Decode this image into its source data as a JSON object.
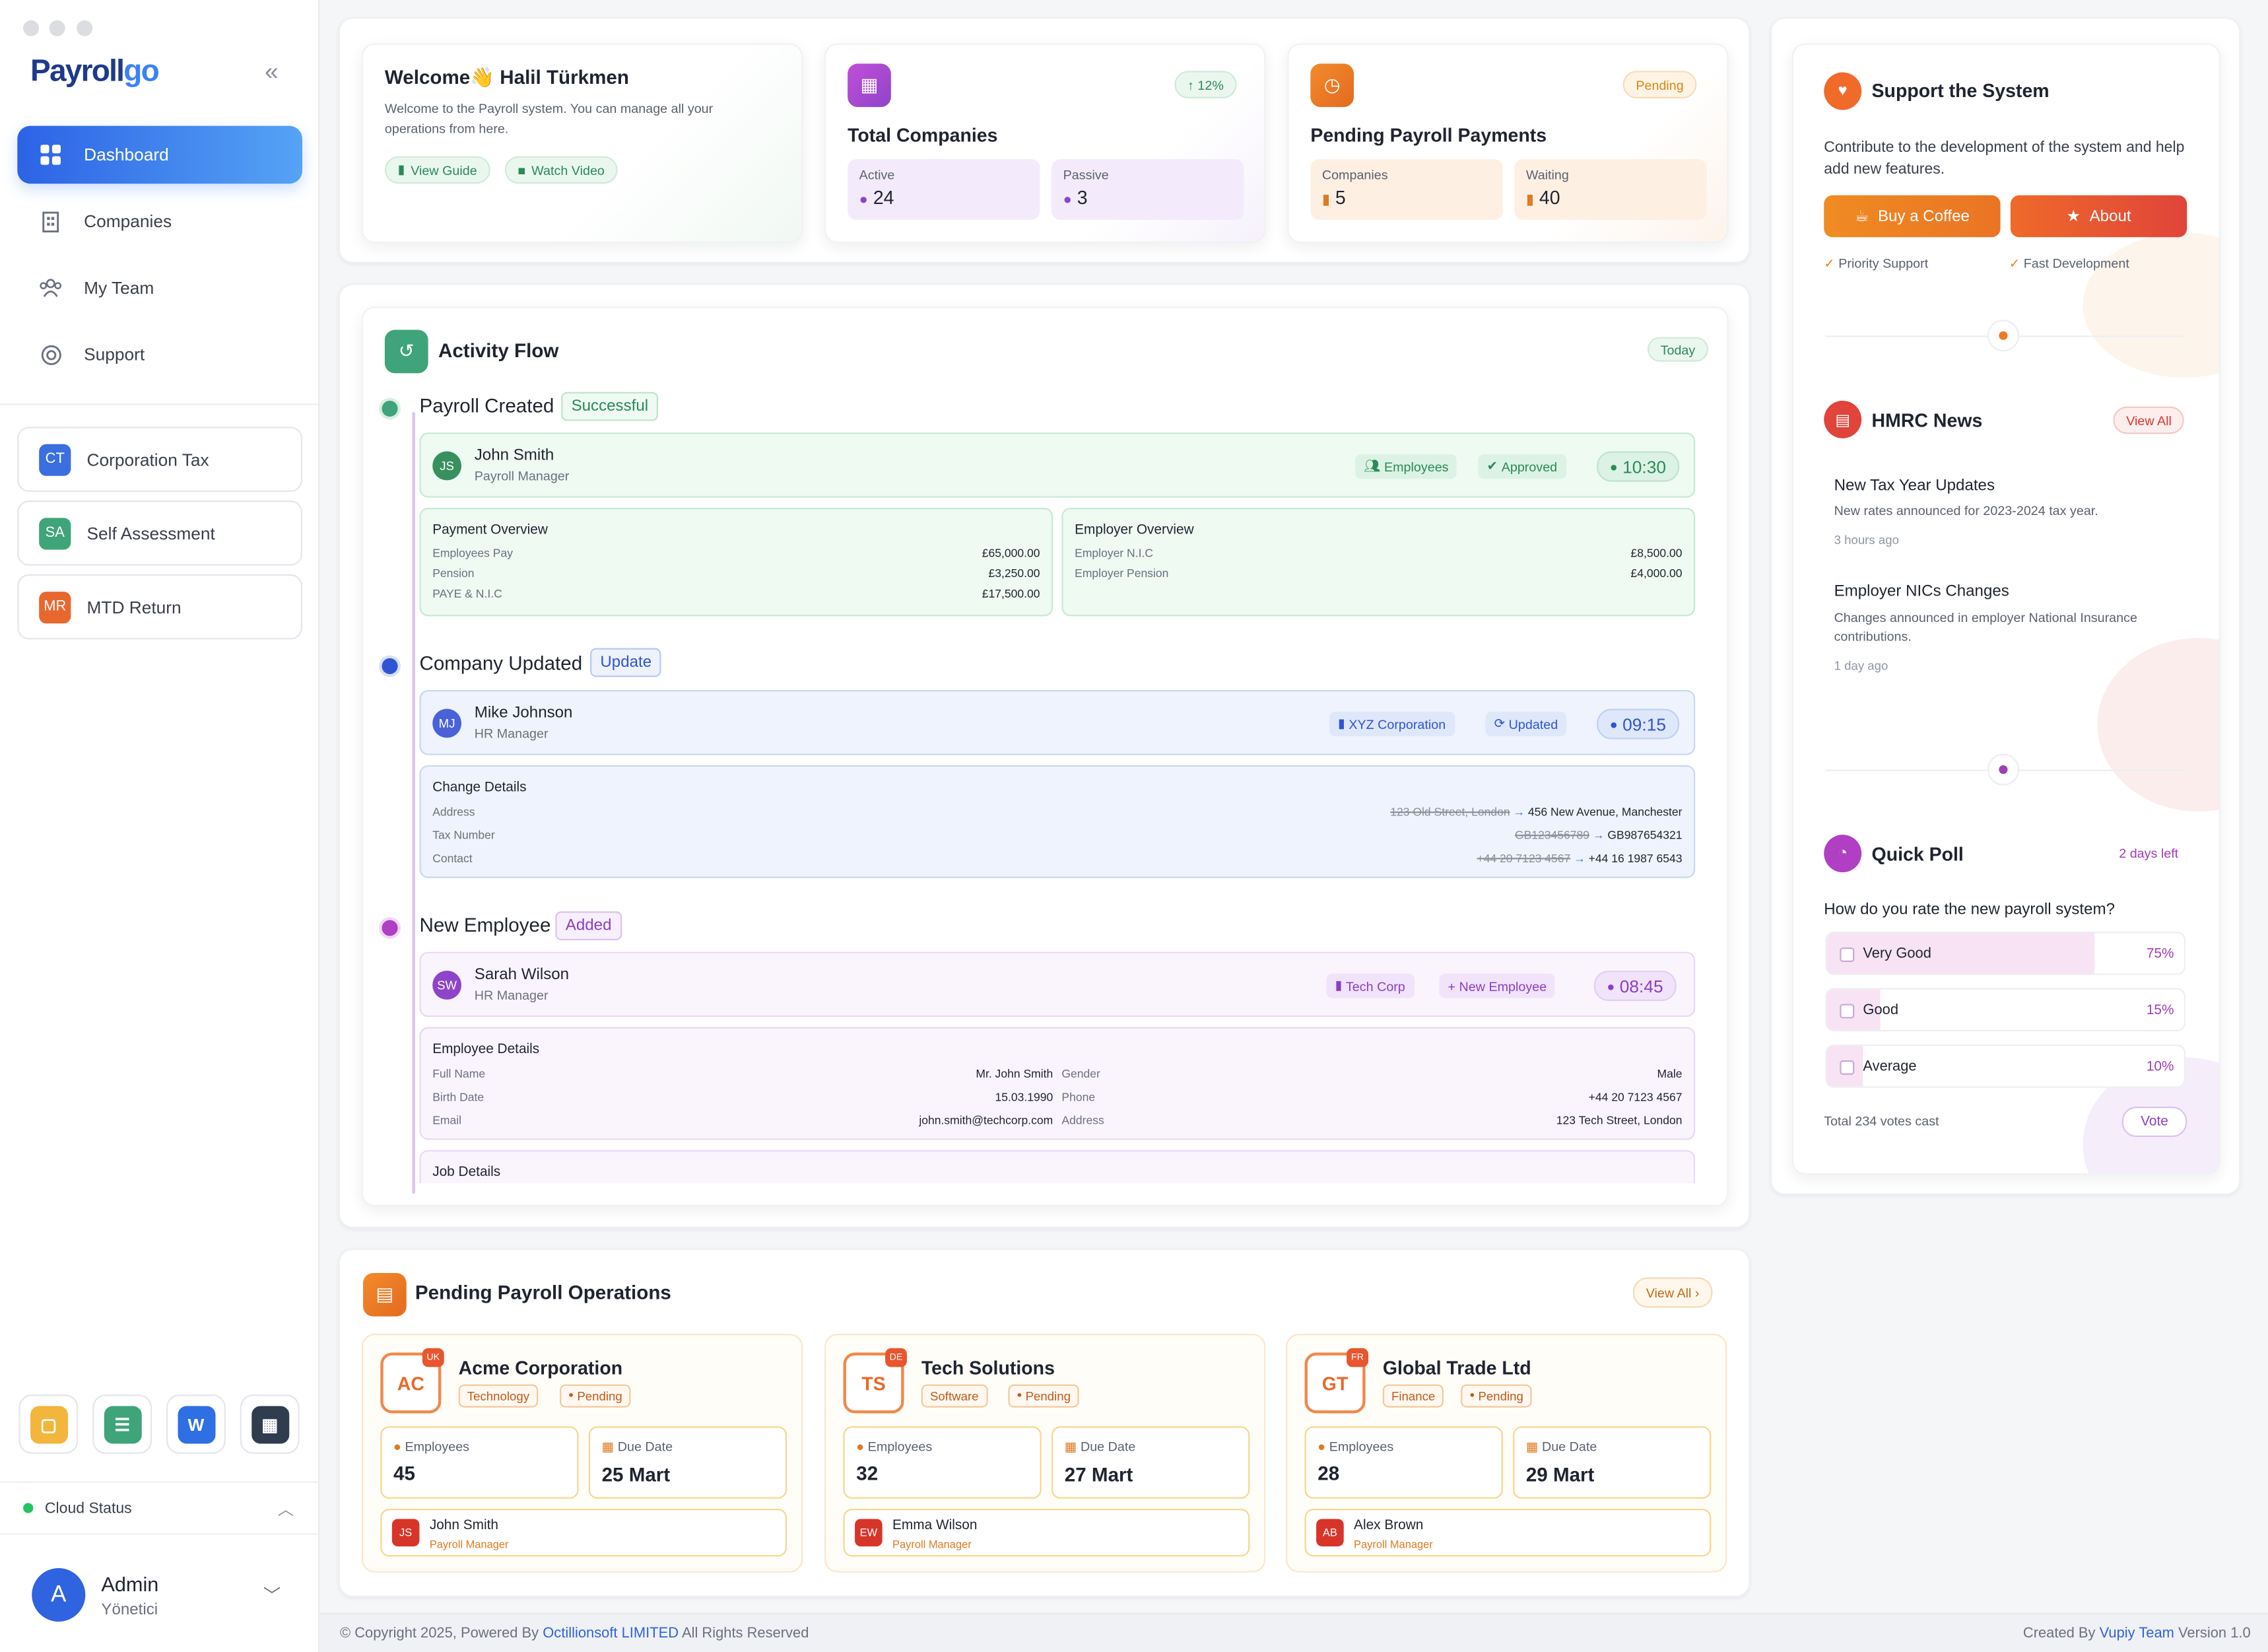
{
  "app": {
    "logo_main": "Payroll",
    "logo_accent": "go"
  },
  "sidebar": {
    "nav": [
      {
        "label": "Dashboard"
      },
      {
        "label": "Companies"
      },
      {
        "label": "My Team"
      },
      {
        "label": "Support"
      }
    ],
    "tax": [
      {
        "badge": "CT",
        "label": "Corporation Tax",
        "color": "#3b6fe0"
      },
      {
        "badge": "SA",
        "label": "Self Assessment",
        "color": "#3fa47a"
      },
      {
        "badge": "MR",
        "label": "MTD Return",
        "color": "#e8672e"
      }
    ],
    "cloud_status": "Cloud Status",
    "user": {
      "initial": "A",
      "name": "Admin",
      "role": "Yönetici"
    }
  },
  "welcome": {
    "title": "Welcome👋 Halil Türkmen",
    "desc": "Welcome to the Payroll system. You can manage all your operations from here.",
    "guide": "View Guide",
    "video": "Watch Video"
  },
  "companies": {
    "title": "Total Companies",
    "change": "↑ 12%",
    "active_label": "Active",
    "active": "24",
    "passive_label": "Passive",
    "passive": "3"
  },
  "pending": {
    "title": "Pending Payroll Payments",
    "status": "Pending",
    "c_label": "Companies",
    "c_val": "5",
    "w_label": "Waiting",
    "w_val": "40"
  },
  "activity": {
    "title": "Activity Flow",
    "badge": "Today",
    "e1": {
      "title": "Payroll Created",
      "status": "Successful",
      "initials": "JS",
      "name": "John Smith",
      "role": "Payroll Manager",
      "tag1": "Employees",
      "tag2": "Approved",
      "time": "10:30",
      "pay_title": "Payment Overview",
      "pay": [
        [
          "Employees Pay",
          "£65,000.00"
        ],
        [
          "Pension",
          "£3,250.00"
        ],
        [
          "PAYE & N.I.C",
          "£17,500.00"
        ]
      ],
      "emp_title": "Employer Overview",
      "emp": [
        [
          "Employer N.I.C",
          "£8,500.00"
        ],
        [
          "Employer Pension",
          "£4,000.00"
        ]
      ]
    },
    "e2": {
      "title": "Company Updated",
      "status": "Update",
      "initials": "MJ",
      "name": "Mike Johnson",
      "role": "HR Manager",
      "tag1": "XYZ Corporation",
      "tag2": "Updated",
      "time": "09:15",
      "chg_title": "Change Details",
      "chg": [
        [
          "Address",
          "123 Old Street, London",
          "456 New Avenue, Manchester"
        ],
        [
          "Tax Number",
          "GB123456789",
          "GB987654321"
        ],
        [
          "Contact",
          "+44 20 7123 4567",
          "+44 16 1987 6543"
        ]
      ]
    },
    "e3": {
      "title": "New Employee",
      "status": "Added",
      "initials": "SW",
      "name": "Sarah Wilson",
      "role": "HR Manager",
      "tag1": "Tech Corp",
      "tag2": "New Employee",
      "time": "08:45",
      "det_title": "Employee Details",
      "left": [
        [
          "Full Name",
          "Mr. John Smith"
        ],
        [
          "Birth Date",
          "15.03.1990"
        ],
        [
          "Email",
          "john.smith@techcorp.com"
        ]
      ],
      "right": [
        [
          "Gender",
          "Male"
        ],
        [
          "Phone",
          "+44 20 7123 4567"
        ],
        [
          "Address",
          "123 Tech Street, London"
        ]
      ],
      "job_title": "Job Details"
    }
  },
  "operations": {
    "title": "Pending Payroll Operations",
    "view_all": "View All",
    "items": [
      {
        "badge": "AC",
        "flag": "UK",
        "name": "Acme Corporation",
        "sector": "Technology",
        "status": "Pending",
        "emp_label": "Employees",
        "emp": "45",
        "due_label": "Due Date",
        "due": "25 Mart",
        "m_init": "JS",
        "m_name": "John Smith",
        "m_role": "Payroll Manager"
      },
      {
        "badge": "TS",
        "flag": "DE",
        "name": "Tech Solutions",
        "sector": "Software",
        "status": "Pending",
        "emp_label": "Employees",
        "emp": "32",
        "due_label": "Due Date",
        "due": "27 Mart",
        "m_init": "EW",
        "m_name": "Emma Wilson",
        "m_role": "Payroll Manager"
      },
      {
        "badge": "GT",
        "flag": "FR",
        "name": "Global Trade Ltd",
        "sector": "Finance",
        "status": "Pending",
        "emp_label": "Employees",
        "emp": "28",
        "due_label": "Due Date",
        "due": "29 Mart",
        "m_init": "AB",
        "m_name": "Alex Brown",
        "m_role": "Payroll Manager"
      }
    ]
  },
  "support": {
    "title": "Support the System",
    "desc": "Contribute to the development of the system and help add new features.",
    "coffee": "Buy a Coffee",
    "about": "About",
    "f1": "Priority Support",
    "f2": "Fast Development"
  },
  "news": {
    "title": "HMRC News",
    "view_all": "View All",
    "items": [
      {
        "title": "New Tax Year Updates",
        "desc": "New rates announced for 2023-2024 tax year.",
        "time": "3 hours ago"
      },
      {
        "title": "Employer NICs Changes",
        "desc": "Changes announced in employer National Insurance contributions.",
        "time": "1 day ago"
      }
    ]
  },
  "poll": {
    "title": "Quick Poll",
    "deadline": "2 days left",
    "question": "How do you rate the new payroll system?",
    "options": [
      {
        "label": "Very Good",
        "pct": "75%",
        "value": 0.75
      },
      {
        "label": "Good",
        "pct": "15%",
        "value": 0.15
      },
      {
        "label": "Average",
        "pct": "10%",
        "value": 0.1
      }
    ],
    "total": "Total 234 votes cast",
    "vote": "Vote"
  },
  "footer": {
    "copy_pre": "© Copyright 2025, Powered By",
    "copy_link": "Octillionsoft LIMITED",
    "copy_post": "All Rights Reserved",
    "created_pre": "Created By",
    "created_link": "Vupiy Team",
    "version": "Version 1.0"
  }
}
